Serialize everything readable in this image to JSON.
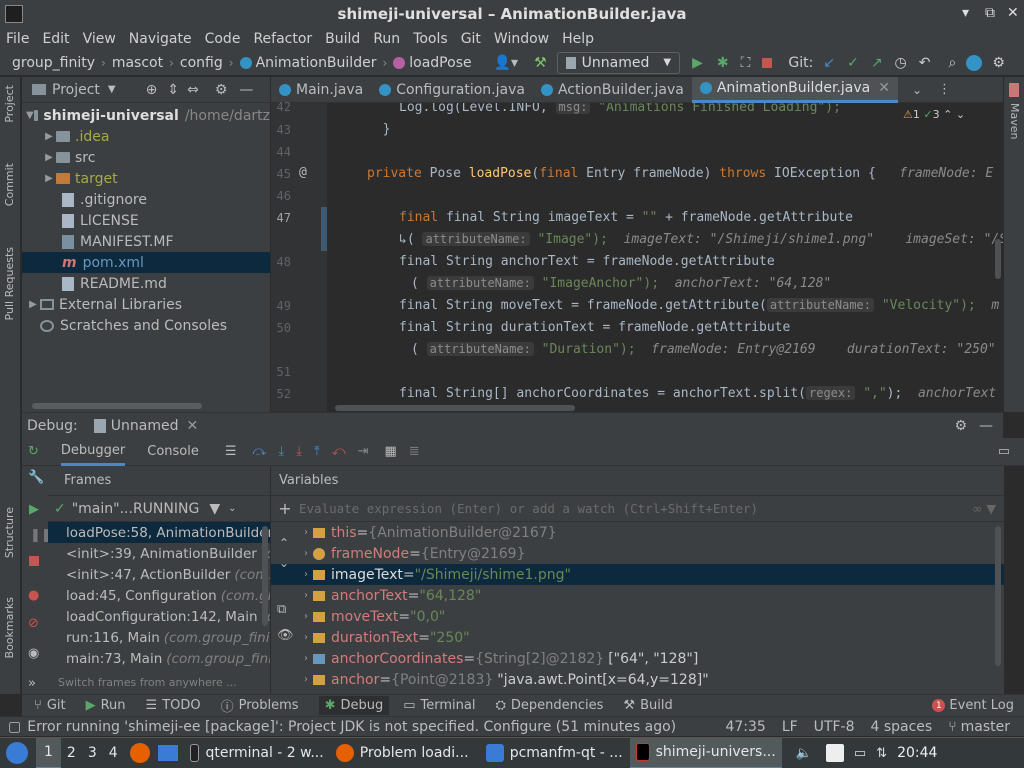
{
  "window": {
    "title": "shimeji-universal – AnimationBuilder.java"
  },
  "menu": [
    "File",
    "Edit",
    "View",
    "Navigate",
    "Code",
    "Refactor",
    "Build",
    "Run",
    "Tools",
    "Git",
    "Window",
    "Help"
  ],
  "nav": {
    "crumbs": [
      "group_finity",
      "mascot",
      "config",
      "AnimationBuilder",
      "loadPose"
    ],
    "run_config": "Unnamed",
    "git_label": "Git:"
  },
  "project_panel": {
    "title": "Project",
    "tree": [
      {
        "label": "shimeji-universal",
        "suffix": "/home/dartz",
        "bold": true,
        "indent": 0
      },
      {
        "label": ".idea",
        "indent": 1,
        "kind": "folder"
      },
      {
        "label": "src",
        "indent": 1,
        "kind": "folder"
      },
      {
        "label": "target",
        "indent": 1,
        "kind": "folder-orange"
      },
      {
        "label": ".gitignore",
        "indent": 1,
        "kind": "file"
      },
      {
        "label": "LICENSE",
        "indent": 1,
        "kind": "file"
      },
      {
        "label": "MANIFEST.MF",
        "indent": 1,
        "kind": "file"
      },
      {
        "label": "pom.xml",
        "indent": 1,
        "kind": "file",
        "selected": true
      },
      {
        "label": "README.md",
        "indent": 1,
        "kind": "file"
      },
      {
        "label": "External Libraries",
        "indent": 0,
        "kind": "lib"
      },
      {
        "label": "Scratches and Consoles",
        "indent": 0,
        "kind": "scratch"
      }
    ]
  },
  "left_strip": [
    "Project",
    "Commit",
    "Pull Requests",
    "Structure",
    "Bookmarks"
  ],
  "right_strip": [
    "Maven"
  ],
  "tabs": [
    "Main.java",
    "Configuration.java",
    "ActionBuilder.java",
    "AnimationBuilder.java"
  ],
  "editor": {
    "warnings": "1",
    "checks": "3",
    "line_numbers": [
      "42",
      "43",
      "44",
      "45",
      "46",
      "47",
      "",
      "48",
      "",
      "49",
      "50",
      "",
      "51",
      "52"
    ],
    "code_line_42": "Log.log(Level.INFO, ",
    "code_line_42_msg": "msg:",
    "code_line_42_str": " \"Animations Finished Loading\");",
    "code_line_45_hint": "frameNode: E",
    "line47_a": "final String imageText = ",
    "line47_b": "\"\"",
    "line47_c": " + frameNode.getAttribute",
    "line47_d_hint": "attributeName:",
    "line47_d_str": "\"Image\");",
    "line47_d_inl": "imageText: \"/Shimeji/shime1.png\"    imageSet: \"/S",
    "line48_a": "final String anchorText = frameNode.getAttribute",
    "line48_b_hint": "attributeName:",
    "line48_b_str": "\"ImageAnchor\");",
    "line48_b_inl": "anchorText: \"64,128\"",
    "line49_a": "final String moveText = frameNode.getAttribute(",
    "line49_hint": "attributeName:",
    "line49_str": "\"Velocity\");",
    "line49_inl": "m",
    "line50_a": "final String durationText = frameNode.getAttribute",
    "line50_b_hint": "attributeName:",
    "line50_b_str": "\"Duration\");",
    "line50_b_inl": "frameNode: Entry@2169    durationText: \"250\"",
    "line52_a": "final String[] anchorCoordinates = anchorText.split(",
    "line52_hint": "regex:",
    "line52_str": "\",\"",
    "line52_end": ");",
    "line52_inl": "anchorText"
  },
  "debug": {
    "label": "Debug:",
    "session": "Unnamed",
    "tabs": [
      "Debugger",
      "Console"
    ],
    "frames_title": "Frames",
    "variables_title": "Variables",
    "thread": "\"main\"...RUNNING",
    "frames": [
      {
        "method": "loadPose:58, AnimationBuilder",
        "loc": "",
        "selected": true
      },
      {
        "method": "<init>:39, AnimationBuilder",
        "loc": "(c"
      },
      {
        "method": "<init>:47, ActionBuilder",
        "loc": "(com."
      },
      {
        "method": "load:45, Configuration",
        "loc": "(com.gr"
      },
      {
        "method": "loadConfiguration:142, Main",
        "loc": "(c"
      },
      {
        "method": "run:116, Main",
        "loc": "(com.group_finit"
      },
      {
        "method": "main:73, Main",
        "loc": "(com.group_finit"
      }
    ],
    "switch_frames": "Switch frames from anywhere ...",
    "eval_placeholder": "Evaluate expression (Enter) or add a watch (Ctrl+Shift+Enter)",
    "variables": [
      {
        "name": "this",
        "type": "{AnimationBuilder@2167}",
        "value": ""
      },
      {
        "name": "frameNode",
        "type": "{Entry@2169}",
        "value": "",
        "param": true
      },
      {
        "name": "imageText",
        "type": "",
        "value": "\"/Shimeji/shime1.png\"",
        "selected": true
      },
      {
        "name": "anchorText",
        "type": "",
        "value": "\"64,128\""
      },
      {
        "name": "moveText",
        "type": "",
        "value": "\"0,0\""
      },
      {
        "name": "durationText",
        "type": "",
        "value": "\"250\""
      },
      {
        "name": "anchorCoordinates",
        "type": "{String[2]@2182}",
        "value": "[\"64\", \"128\"]",
        "array": true
      },
      {
        "name": "anchor",
        "type": "{Point@2183}",
        "value": "\"java.awt.Point[x=64,y=128]\""
      }
    ]
  },
  "tool_windows": [
    "Git",
    "Run",
    "TODO",
    "Problems",
    "Debug",
    "Terminal",
    "Dependencies",
    "Build"
  ],
  "event_log": {
    "count": "1",
    "label": "Event Log"
  },
  "status": {
    "message": "Error running 'shimeji-ee [package]': Project JDK is not specified. Configure (51 minutes ago)",
    "position": "47:35",
    "line_sep": "LF",
    "encoding": "UTF-8",
    "indent": "4 spaces",
    "branch": "master"
  },
  "taskbar": {
    "workspaces": [
      "1",
      "2",
      "3",
      "4"
    ],
    "apps": [
      {
        "label": "qterminal - 2 w...",
        "color": "#222"
      },
      {
        "label": "Problem loadi...",
        "color": "#e66000"
      },
      {
        "label": "pcmanfm-qt - ...",
        "color": "#3a7bd5"
      },
      {
        "label": "shimeji-univers...",
        "color": "#000",
        "active": true
      }
    ],
    "clock": "20:44"
  }
}
